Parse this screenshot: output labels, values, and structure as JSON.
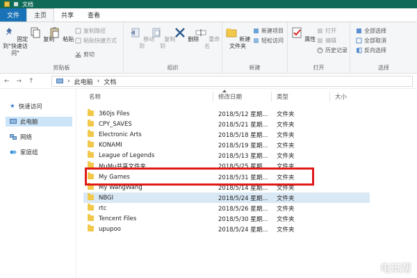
{
  "window": {
    "title": "文档"
  },
  "tabs": [
    {
      "label": "文件"
    },
    {
      "label": "主页"
    },
    {
      "label": "共享"
    },
    {
      "label": "查看"
    }
  ],
  "ribbon": {
    "clipboard": {
      "pin_label": "固定到\"快速访问\"",
      "copy_label": "复制",
      "paste_label": "粘贴",
      "copy_path_label": "复制路径",
      "paste_shortcut_label": "粘贴快捷方式",
      "cut_label": "剪切",
      "group_label": "剪贴板"
    },
    "organize": {
      "move_to_label": "移动到",
      "copy_to_label": "复制到",
      "delete_label": "删除",
      "rename_label": "重命名",
      "group_label": "组织"
    },
    "new": {
      "new_folder_label": "新建文件夹",
      "new_item_label": "新建项目",
      "easy_access_label": "轻松访问",
      "group_label": "新建"
    },
    "open": {
      "properties_label": "属性",
      "open_label": "打开",
      "edit_label": "编辑",
      "history_label": "历史记录",
      "group_label": "打开"
    },
    "select": {
      "select_all_label": "全部选择",
      "select_none_label": "全部取消",
      "invert_label": "反向选择",
      "group_label": "选择"
    }
  },
  "address": {
    "breadcrumb_root": "此电脑",
    "breadcrumb_current": "文档"
  },
  "nav": [
    {
      "label": "快速访问"
    },
    {
      "label": "此电脑"
    },
    {
      "label": "网络"
    },
    {
      "label": "家庭组"
    }
  ],
  "columns": {
    "name": "名称",
    "date": "修改日期",
    "type": "类型",
    "size": "大小"
  },
  "files": [
    {
      "name": "360js Files",
      "date": "2018/5/12 星期...",
      "type": "文件夹"
    },
    {
      "name": "CPY_SAVES",
      "date": "2018/5/21 星期...",
      "type": "文件夹"
    },
    {
      "name": "Electronic Arts",
      "date": "2018/5/18 星期...",
      "type": "文件夹"
    },
    {
      "name": "KONAMI",
      "date": "2018/5/19 星期...",
      "type": "文件夹"
    },
    {
      "name": "League of Legends",
      "date": "2018/5/13 星期...",
      "type": "文件夹"
    },
    {
      "name": "MuMu共享文件夹",
      "date": "2018/5/25 星期...",
      "type": "文件夹"
    },
    {
      "name": "My Games",
      "date": "2018/5/31 星期...",
      "type": "文件夹"
    },
    {
      "name": "My WangWang",
      "date": "2018/5/14 星期...",
      "type": "文件夹"
    },
    {
      "name": "NBGI",
      "date": "2018/5/24 星期...",
      "type": "文件夹"
    },
    {
      "name": "rtc",
      "date": "2018/5/26 星期...",
      "type": "文件夹"
    },
    {
      "name": "Tencent Files",
      "date": "2018/5/30 星期...",
      "type": "文件夹"
    },
    {
      "name": "upupoo",
      "date": "2018/5/24 星期...",
      "type": "文件夹"
    }
  ],
  "watermark": "电玩帮"
}
